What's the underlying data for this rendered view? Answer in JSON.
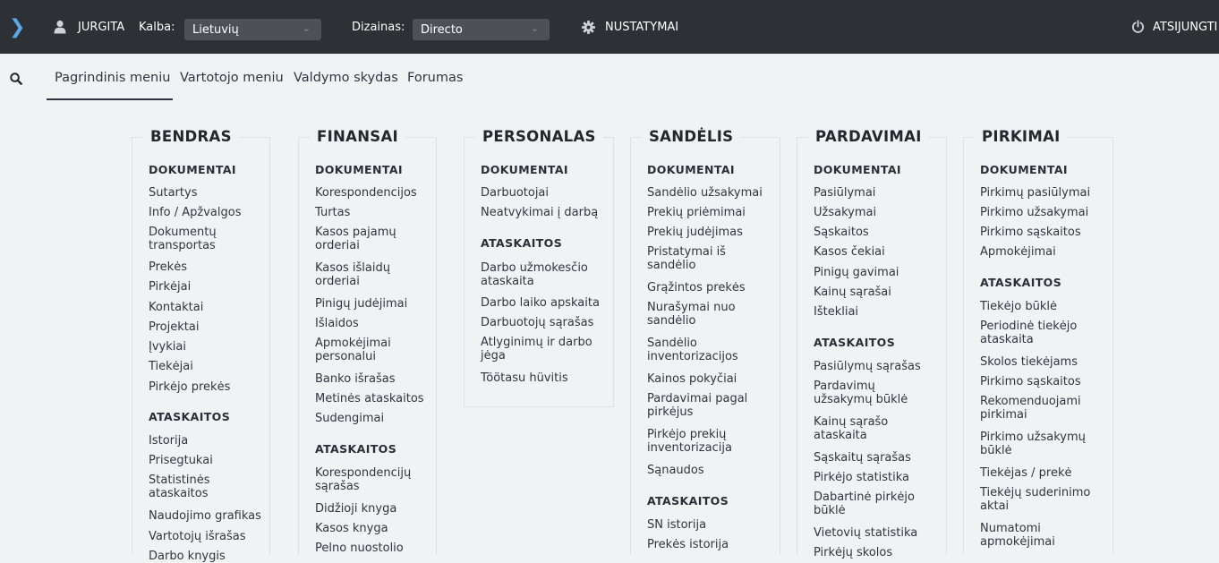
{
  "topbar": {
    "toggle_icon": "chevron-right-icon",
    "user_icon": "user-icon",
    "user": "JURGITA",
    "language_label": "Kalba:",
    "language_value": "Lietuvių",
    "design_label": "Dizainas:",
    "design_value": "Directo",
    "settings_icon": "gear-icon",
    "settings": "NUSTATYMAI",
    "logout_icon": "power-icon",
    "logout": "ATSIJUNGTI",
    "colors": {
      "bar": "#2d3035",
      "accent": "#5aa8e6"
    }
  },
  "nav": {
    "search_icon": "search-icon",
    "tabs": [
      "Pagrindinis meniu",
      "Vartotojo meniu",
      "Valdymo skydas",
      "Forumas"
    ]
  },
  "columns": [
    {
      "title": "BENDRAS",
      "sections": [
        {
          "title": "DOKUMENTAI",
          "items": [
            "Sutartys",
            "Info / Apžvalgos",
            "Dokumentų transportas",
            "Prekės",
            "Pirkėjai",
            "Kontaktai",
            "Projektai",
            "Įvykiai",
            "Tiekėjai",
            "Pirkėjo prekės"
          ]
        },
        {
          "title": "ATASKAITOS",
          "items": [
            "Istorija",
            "Prisegtukai",
            "Statistinės ataskaitos",
            "Naudojimo grafikas",
            "Vartotojų išrašas",
            "Darbo knygis"
          ]
        }
      ]
    },
    {
      "title": "FINANSAI",
      "sections": [
        {
          "title": "DOKUMENTAI",
          "items": [
            "Korespondencijos",
            "Turtas",
            "Kasos pajamų orderiai",
            "Kasos išlaidų orderiai",
            "Pinigų judėjimai",
            "Išlaidos",
            "Apmokėjimai personalui",
            "Banko išrašas",
            "Metinės ataskaitos",
            "Sudengimai"
          ]
        },
        {
          "title": "ATASKAITOS",
          "items": [
            "Korespondencijų sąrašas",
            "Didžioji knyga",
            "Kasos knyga",
            "Pelno nuostolio"
          ]
        }
      ]
    },
    {
      "title": "PERSONALAS",
      "sections": [
        {
          "title": "DOKUMENTAI",
          "items": [
            "Darbuotojai",
            "Neatvykimai į darbą"
          ]
        },
        {
          "title": "ATASKAITOS",
          "items": [
            "Darbo užmokesčio ataskaita",
            "Darbo laiko apskaita",
            "Darbuotojų sąrašas",
            "Atlyginimų ir darbo jėga",
            "Töötasu hüvitis"
          ]
        }
      ]
    },
    {
      "title": "SANDĖLIS",
      "sections": [
        {
          "title": "DOKUMENTAI",
          "items": [
            "Sandėlio užsakymai",
            "Prekių priėmimai",
            "Prekių judėjimas",
            "Pristatymai iš sandėlio",
            "Grąžintos prekės",
            "Nurašymai nuo sandėlio",
            "Sandėlio inventorizacijos",
            "Kainos pokyčiai",
            "Pardavimai pagal pirkėjus",
            "Pirkėjo prekių inventorizacija",
            "Sąnaudos"
          ]
        },
        {
          "title": "ATASKAITOS",
          "items": [
            "SN istorija",
            "Prekės istorija"
          ]
        }
      ]
    },
    {
      "title": "PARDAVIMAI",
      "sections": [
        {
          "title": "DOKUMENTAI",
          "items": [
            "Pasiūlymai",
            "Užsakymai",
            "Sąskaitos",
            "Kasos čekiai",
            "Pinigų gavimai",
            "Kainų sąrašai",
            "Ištekliai"
          ]
        },
        {
          "title": "ATASKAITOS",
          "items": [
            "Pasiūlymų sąrašas",
            "Pardavimų užsakymų būklė",
            "Kainų sąrašo ataskaita",
            "Sąskaitų sąrašas",
            "Pirkėjo statistika",
            "Dabartinė pirkėjo būklė",
            "Vietovių statistika",
            "Pirkėjų skolos"
          ]
        }
      ]
    },
    {
      "title": "PIRKIMAI",
      "sections": [
        {
          "title": "DOKUMENTAI",
          "items": [
            "Pirkimų pasiūlymai",
            "Pirkimo užsakymai",
            "Pirkimo sąskaitos",
            "Apmokėjimai"
          ]
        },
        {
          "title": "ATASKAITOS",
          "items": [
            "Tiekėjo būklė",
            "Periodinė tiekėjo ataskaita",
            "Skolos tiekėjams",
            "Pirkimo sąskaitos",
            "Rekomenduojami pirkimai",
            "Pirkimo užsakymų būklė",
            "Tiekėjas / prekė",
            "Tiekėjų suderinimo aktai",
            "Numatomi apmokėjimai"
          ]
        }
      ]
    }
  ]
}
